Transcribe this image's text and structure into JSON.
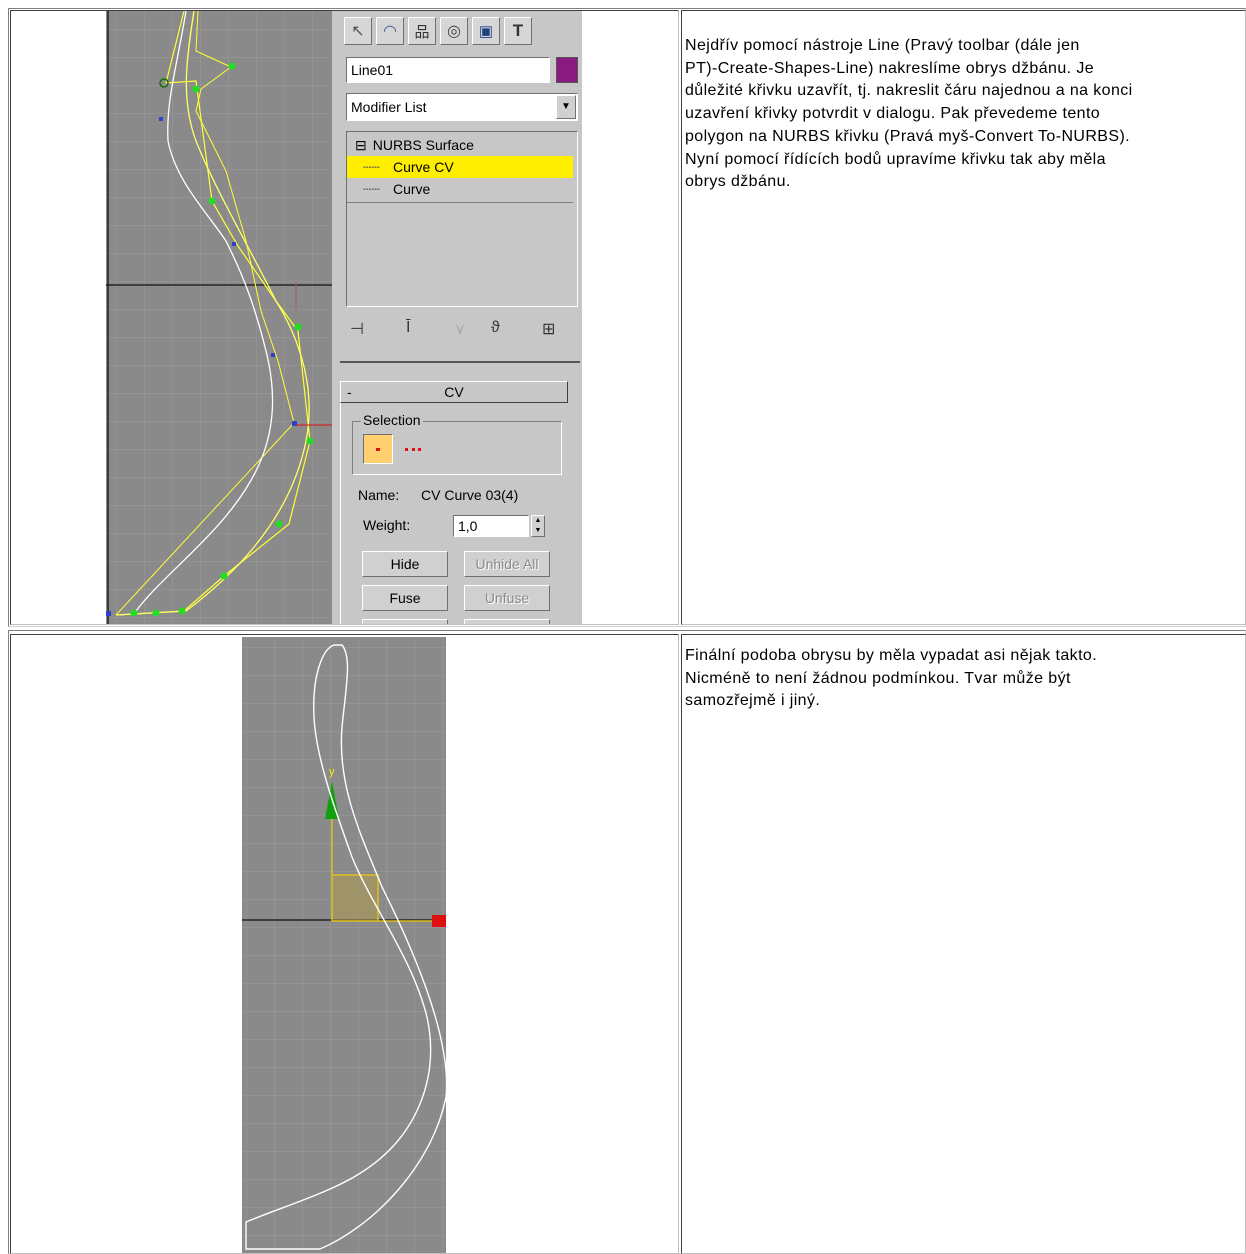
{
  "rows": [
    {
      "description_lines": [
        "Nejdřív pomocí nástroje Line (Pravý toolbar (dále jen",
        "PT)-Create-Shapes-Line) nakreslíme obrys džbánu. Je",
        "důležité křivku uzavřít, tj. nakreslit čáru najednou a na konci",
        "uzavření křivky potvrdit v dialogu. Pak převedeme tento",
        "polygon na NURBS křivku (Pravá myš-Convert To-NURBS).",
        "Nyní pomocí řídících bodů upravíme křivku tak aby měla",
        "obrys džbánu."
      ]
    },
    {
      "description_lines": [
        "Finální podoba obrysu by měla vypadat asi nějak takto.",
        "Nicméně to není žádnou podmínkou. Tvar může být",
        "samozřejmě i jiný."
      ]
    }
  ],
  "max_panel": {
    "object_name": "Line01",
    "object_color": "#8b1a7e",
    "modifier_list": "Modifier List",
    "stack": [
      {
        "label": "NURBS Surface",
        "icon": "⊟"
      },
      {
        "label": "Curve CV",
        "selected": true
      },
      {
        "label": "Curve"
      }
    ],
    "rollout_toggle": "-",
    "rollout_title": "CV",
    "selection_label": "Selection",
    "name_label": "Name:",
    "name_value": "CV Curve 03(4)",
    "weight_label": "Weight:",
    "weight_value": "1,0",
    "buttons": {
      "hide": "Hide",
      "unhide_all": "Unhide All",
      "fuse": "Fuse",
      "unfuse": "Unfuse"
    }
  },
  "colors": {
    "viewport_bg": "#8a8a8a",
    "grid": "#9c9c9c",
    "highlight": "#ffee00",
    "cv_points": "#22dd22",
    "curve_yellow": "#ffff33",
    "axis_red": "#e01010",
    "axis_green": "#10a010"
  }
}
